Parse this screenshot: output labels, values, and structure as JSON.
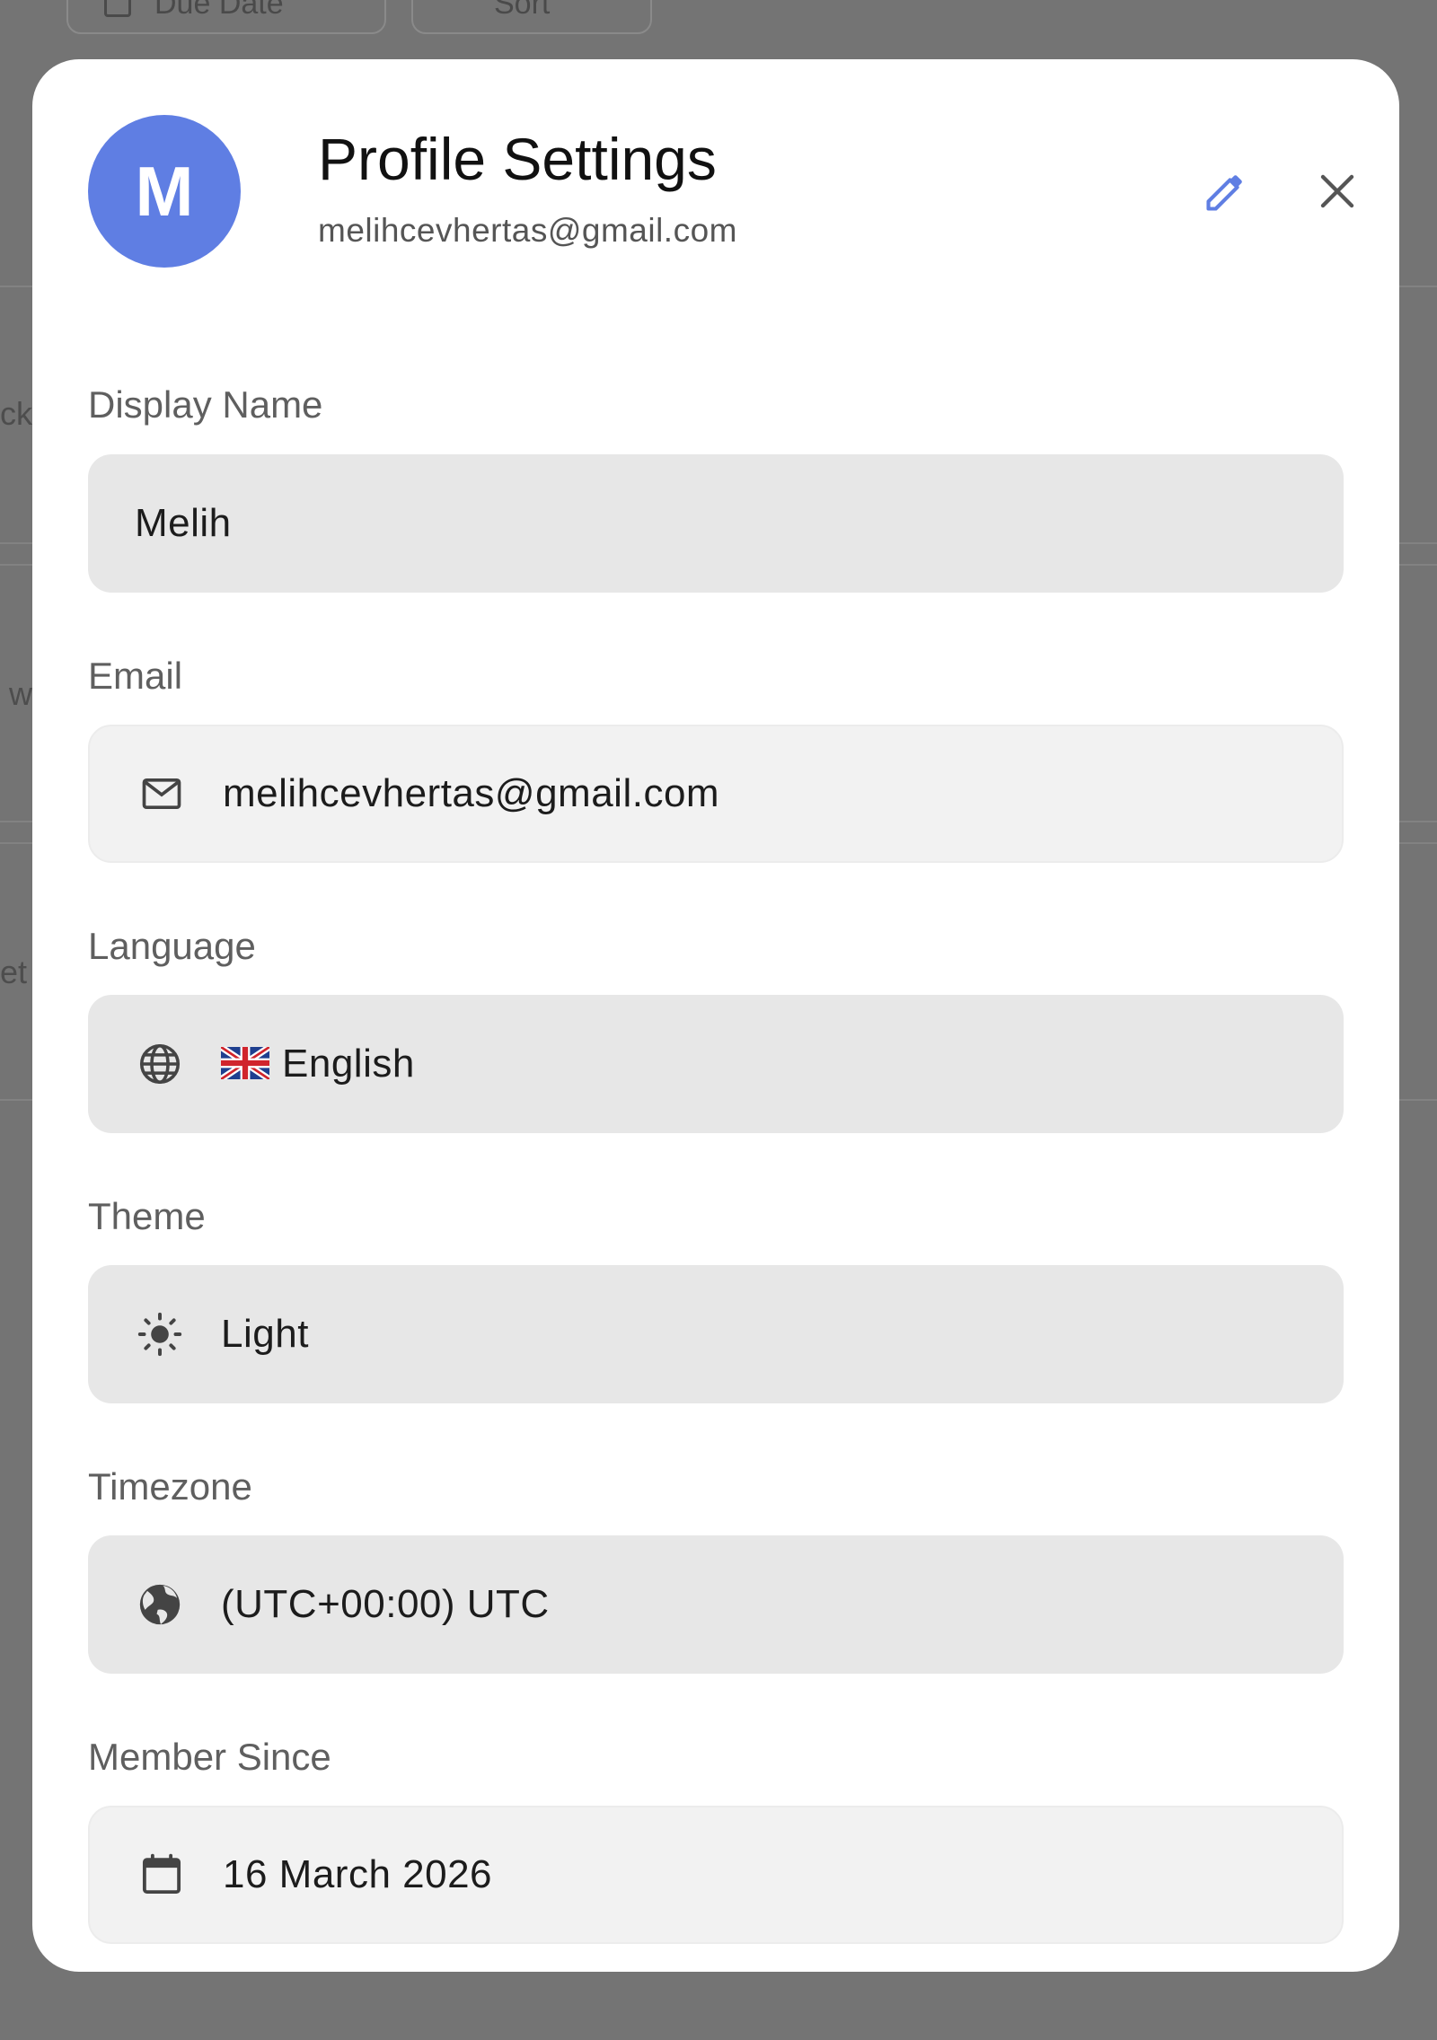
{
  "background": {
    "chips": [
      "Due Date",
      "Sort"
    ],
    "text_fragments": [
      "ck",
      "w",
      "et"
    ]
  },
  "colors": {
    "accent": "#5f7ee3",
    "overlay": "#747474",
    "modal": "#ffffff",
    "field_filled": "#e7e7e7",
    "field_readonly": "#f2f2f2"
  },
  "profile": {
    "avatar_letter": "M",
    "title": "Profile Settings",
    "email": "melihcevhertas@gmail.com",
    "edit_icon": "pencil-icon",
    "close_icon": "close-icon"
  },
  "fields": {
    "display_name": {
      "label": "Display Name",
      "value": "Melih"
    },
    "email": {
      "label": "Email",
      "value": "melihcevhertas@gmail.com",
      "icon": "mail-icon"
    },
    "language": {
      "label": "Language",
      "value": "English",
      "icon": "globe-icon",
      "flag": "uk-flag-icon"
    },
    "theme": {
      "label": "Theme",
      "value": "Light",
      "icon": "sun-icon"
    },
    "timezone": {
      "label": "Timezone",
      "value": "(UTC+00:00) UTC",
      "icon": "earth-icon"
    },
    "member_since": {
      "label": "Member Since",
      "value": "16 March 2026",
      "icon": "calendar-icon"
    }
  }
}
